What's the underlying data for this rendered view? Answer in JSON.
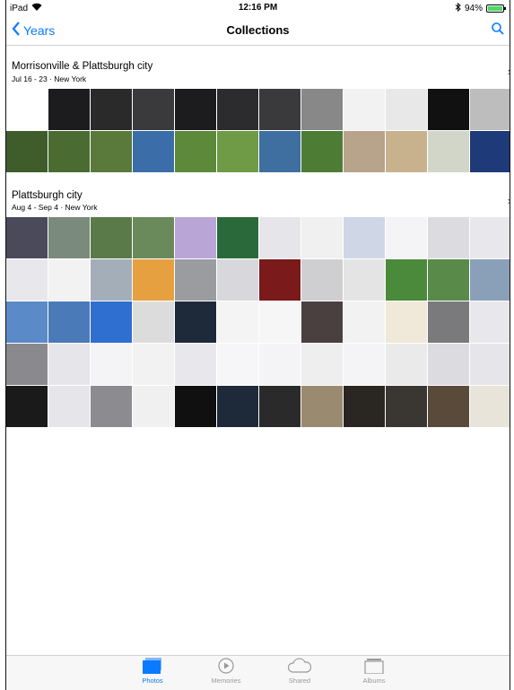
{
  "status": {
    "device": "iPad",
    "time": "12:16 PM",
    "battery": "94%"
  },
  "nav": {
    "back_label": "Years",
    "title": "Collections"
  },
  "collections": [
    {
      "title": "Morrisonville & Plattsburgh city",
      "subtitle": "Jul 16 - 23 · New York",
      "rows": [
        [
          "#ffffff",
          "#1c1c1e",
          "#2a2a2a",
          "#3a3a3c",
          "#1c1c1e",
          "#2c2c2e",
          "#3a3a3c",
          "#888888",
          "#f2f2f2",
          "#e8e8e8",
          "#111111",
          "#bdbdbd"
        ],
        [
          "#3e5d2b",
          "#4a6b31",
          "#5a7a3c",
          "#3b6ea8",
          "#5c8a3a",
          "#6f9a46",
          "#3e6fa0",
          "#4d7c35",
          "#b7a48a",
          "#c8b28e",
          "#d2d6c8",
          "#1f3a78"
        ]
      ]
    },
    {
      "title": "Plattsburgh city",
      "subtitle": "Aug 4 - Sep 4 · New York",
      "rows": [
        [
          "#4a4a5a",
          "#7a8a7c",
          "#5b7a4a",
          "#6a8a5c",
          "#b9a6d6",
          "#2a6a3a",
          "#e6e6ea",
          "#f0f0f0",
          "#cfd6e6",
          "#f4f4f6",
          "#dcdce0",
          "#e8e8ec"
        ],
        [
          "#e8e8ec",
          "#f2f2f2",
          "#a4aeb8",
          "#e6a040",
          "#9a9ca0",
          "#d8d8dc",
          "#7a1a1a",
          "#cfcfd2",
          "#e4e4e4",
          "#4a8a3a",
          "#5a8a4a",
          "#8aa0b8"
        ],
        [
          "#5a8ac8",
          "#4a7ab8",
          "#2f6fd0",
          "#dcdcdc",
          "#1e2a3a",
          "#f4f4f4",
          "#f6f6f6",
          "#4a4040",
          "#f2f2f2",
          "#f0e8d8",
          "#7a7a7c",
          "#e8e8ec"
        ],
        [
          "#8a8a8e",
          "#e6e6ea",
          "#f4f4f6",
          "#f2f2f2",
          "#e8e8ec",
          "#f6f6f8",
          "#f4f4f6",
          "#eeeeee",
          "#f4f4f6",
          "#eaeaea",
          "#dcdce0",
          "#e6e6ea"
        ],
        [
          "#1a1a1a",
          "#e6e6ea",
          "#8c8c90",
          "#f0f0f0",
          "#101010",
          "#1e2a3a",
          "#2a2a2a",
          "#9a8a70",
          "#2a2622",
          "#3a3632",
          "#5a4a3a",
          "#e8e4da"
        ]
      ]
    }
  ],
  "tabs": [
    {
      "label": "Photos",
      "icon": "photos-icon",
      "active": true
    },
    {
      "label": "Memories",
      "icon": "memories-icon",
      "active": false
    },
    {
      "label": "Shared",
      "icon": "cloud-icon",
      "active": false
    },
    {
      "label": "Albums",
      "icon": "albums-icon",
      "active": false
    }
  ],
  "colors": {
    "accent": "#0a7aff",
    "inactive": "#999999"
  }
}
